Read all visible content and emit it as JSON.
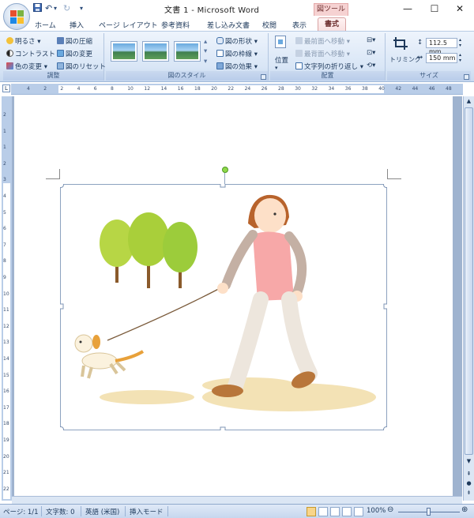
{
  "window": {
    "title": "文書 1 - Microsoft Word",
    "context_title": "図ツール"
  },
  "qat": {
    "undo_label": "↶",
    "redo_label": "↻",
    "customize_label": "▾"
  },
  "tabs": [
    "ホーム",
    "挿入",
    "ページ レイアウト",
    "参考資料",
    "差し込み文書",
    "校閲",
    "表示"
  ],
  "active_tab": "書式",
  "ribbon": {
    "adjust": {
      "label": "調整",
      "items": [
        "明るさ",
        "コントラスト",
        "色の変更",
        "図の圧縮",
        "図の変更",
        "図のリセット"
      ]
    },
    "styles": {
      "label": "図のスタイル",
      "items": [
        "図の形状",
        "図の枠線",
        "図の効果"
      ]
    },
    "arrange": {
      "label": "配置",
      "position_label": "位置",
      "items": [
        "最前面へ移動",
        "最背面へ移動",
        "文字列の折り返し"
      ]
    },
    "size": {
      "label": "サイズ",
      "crop_label": "トリミング",
      "height": "112.5 mm",
      "width": "150 mm"
    }
  },
  "ruler": {
    "h_ticks": [
      "4",
      "2",
      "2",
      "4",
      "6",
      "8",
      "10",
      "12",
      "14",
      "16",
      "18",
      "20",
      "22",
      "24",
      "26",
      "28",
      "30",
      "32",
      "34",
      "36",
      "38",
      "40",
      "42",
      "44",
      "46",
      "48"
    ],
    "v_ticks": [
      "2",
      "1",
      "1",
      "2",
      "3",
      "4",
      "5",
      "6",
      "7",
      "8",
      "9",
      "10",
      "11",
      "12",
      "13",
      "14",
      "15",
      "16",
      "17",
      "18",
      "19",
      "20",
      "21",
      "22"
    ],
    "corner_label": "L"
  },
  "status": {
    "page": "ページ: 1/1",
    "words": "文字数: 0",
    "language": "英語 (米国)",
    "mode": "挿入モード",
    "zoom": "100%"
  }
}
